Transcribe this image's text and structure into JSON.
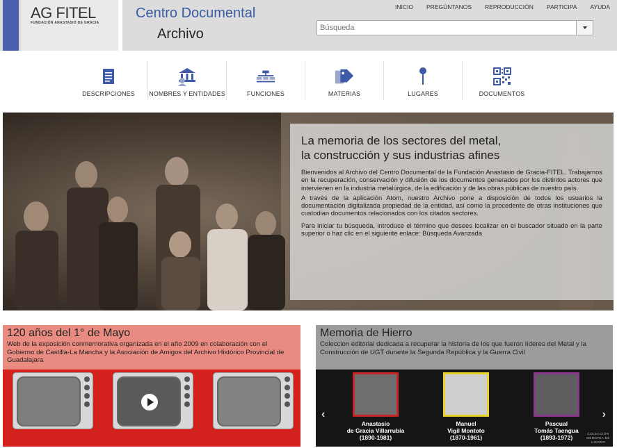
{
  "header": {
    "logo_text": "AG  FITEL",
    "logo_sub": "FUNDACIÓN ANASTASIO DE GRACIA",
    "site_title": "Centro Documental",
    "site_subtitle": "Archivo",
    "search_placeholder": "Búsqueda",
    "topnav": [
      "INICIO",
      "PREGÚNTANOS",
      "REPRODUCCIÓN",
      "PARTICIPA",
      "AYUDA"
    ]
  },
  "nav": [
    {
      "label": "DESCRIPCIONES",
      "icon": "document-icon"
    },
    {
      "label": "NOMBRES Y ENTIDADES",
      "icon": "institution-icon"
    },
    {
      "label": "FUNCIONES",
      "icon": "functions-icon"
    },
    {
      "label": "MATERIAS",
      "icon": "tags-icon"
    },
    {
      "label": "LUGARES",
      "icon": "location-pin-icon"
    },
    {
      "label": "DOCUMENTOS",
      "icon": "qr-code-icon"
    }
  ],
  "hero": {
    "title_line1": "La memoria de los sectores del metal,",
    "title_line2": "la construcción y sus industrias afines",
    "p1": "Bienvenidos al Archivo del Centro Documental de la Fundación Anastasio de Gracia-FITEL. Trabajamos en la recuperación, conservación y difusión de los documentos generados por los distintos actores que intervienen en la industria metalúrgica, de la edificación y de las obras públicas de nuestro país.",
    "p2": "A través de la aplicación Atom, nuestro Archivo pone a disposición de todos los usuarios la documentación digitalizada propiedad de la entidad, así como la procedente de otras instituciones que custodian documentos relacionados con los citados sectores.",
    "p3_text": "Para iniciar tu búsqueda, introduce el término que desees localizar en el buscador situado en la parte superior o haz clic en el siguiente enlace:",
    "p3_link": "Búsqueda Avanzada"
  },
  "cards": {
    "left": {
      "title": "120 años del 1° de Mayo",
      "desc": "Web de la exposición conmemorativa organizada en el año 2009 en colaboración con el Gobierno de Castilla-La Mancha y la Asociación de Amigos del Archivo Histórico Provincial de Guadalajara"
    },
    "right": {
      "title": "Memoria de Hierro",
      "desc": "Coleccion editorial dedicada a recuperar la historia de los que fueron líderes del Metal y la Construcción de UGT durante la Segunda República y la Guerra Civil",
      "people": [
        {
          "line1": "Anastasio",
          "line2": "de Gracia Villarrubia",
          "years": "(1890-1981)",
          "color": "#c8262b"
        },
        {
          "line1": "Manuel",
          "line2": "Vigil Montoto",
          "years": "(1870-1961)",
          "color": "#e8d224"
        },
        {
          "line1": "Pascual",
          "line2": "Tomás Taengua",
          "years": "(1893-1972)",
          "color": "#8a3a8c"
        }
      ],
      "collection_mark": "COLECCIÓN MEMORIA DE HIERRO"
    }
  },
  "colors": {
    "accent_blue": "#4a5fae",
    "title_blue": "#3b5ba5",
    "card_left_bg": "#e98b80",
    "card_left_img": "#d3221d",
    "card_right_bg": "#9c9c9c"
  }
}
